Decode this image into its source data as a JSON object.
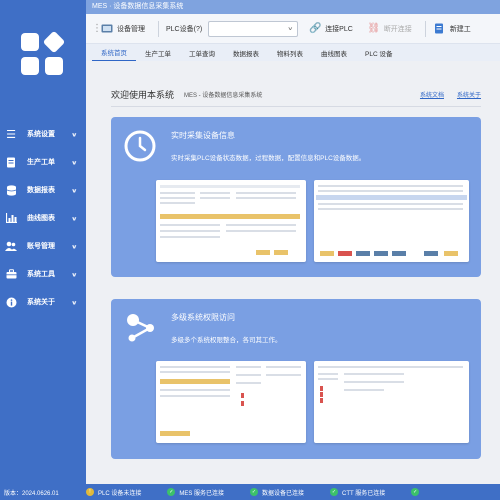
{
  "window": {
    "title": "MES · 设备数据信息采集系统"
  },
  "sidebar": {
    "items": [
      {
        "label": "系统设置",
        "icon": "menu-icon"
      },
      {
        "label": "生产工单",
        "icon": "document-icon"
      },
      {
        "label": "数据报表",
        "icon": "database-icon"
      },
      {
        "label": "曲线图表",
        "icon": "chart-icon"
      },
      {
        "label": "账号管理",
        "icon": "users-icon"
      },
      {
        "label": "系统工具",
        "icon": "toolbox-icon"
      },
      {
        "label": "系统关于",
        "icon": "info-icon"
      }
    ]
  },
  "toolbar": {
    "device_manage": "设备管理",
    "plc_label": "PLC设备(?)",
    "plc_select_value": "",
    "connect_plc": "连接PLC",
    "disconnect": "断开连接",
    "new_tab": "新建工"
  },
  "tabs": [
    "系统首页",
    "生产工单",
    "工单查询",
    "数据报表",
    "物料列表",
    "曲线图表",
    "PLC 设备"
  ],
  "main": {
    "welcome_title": "欢迎使用本系统",
    "welcome_subtitle": "MES - 设备数据信息采集系统",
    "link_docs": "系统文档",
    "link_about": "系统关于",
    "card1": {
      "title": "实时采集设备信息",
      "desc": "实时采集PLC设备状态数据，过程数据，配置信息和PLC设备数据。"
    },
    "card2": {
      "title": "多级系统权限访问",
      "desc": "多级多个系统权限整合，各司其工作。"
    }
  },
  "statusbar": {
    "version": "版本：2024.0626.01",
    "items": [
      {
        "label": "PLC 设备未连接",
        "state": "warn"
      },
      {
        "label": "MES 服务已连接",
        "state": "ok"
      },
      {
        "label": "数据设备已连接",
        "state": "ok"
      },
      {
        "label": "CTT 服务已连接",
        "state": "ok"
      },
      {
        "label": "",
        "state": "ok"
      }
    ]
  },
  "colors": {
    "sidebar": "#3f6fc6",
    "card": "#7a9fe3",
    "accent": "#2f66c6",
    "ok": "#3cc16a",
    "warn": "#e0b93a"
  }
}
